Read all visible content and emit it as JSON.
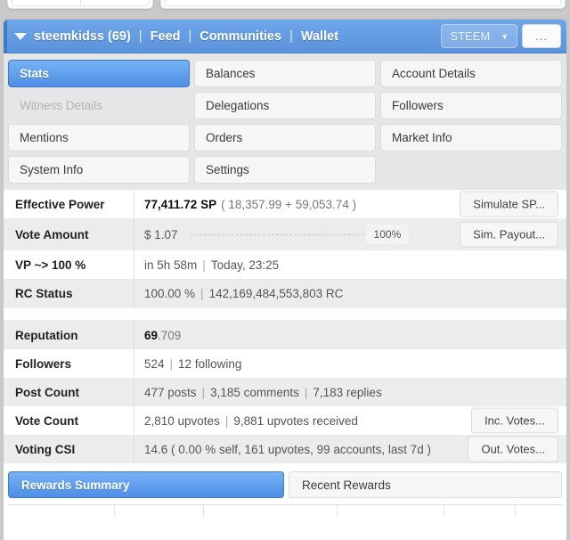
{
  "header": {
    "caret_icon": "caret-down-icon",
    "account": "steemkidss (69)",
    "nav_feed": "Feed",
    "nav_communities": "Communities",
    "nav_wallet": "Wallet",
    "separator": "|",
    "currency_selected": "STEEM",
    "currency_caret_icon": "chevron-down-icon",
    "more_label": "...",
    "accent_color": "#5b93dc"
  },
  "tabs": [
    {
      "label": "Stats",
      "state": "active"
    },
    {
      "label": "Balances",
      "state": "idle"
    },
    {
      "label": "Account Details",
      "state": "idle"
    },
    {
      "label": "Witness Details",
      "state": "disabled"
    },
    {
      "label": "Delegations",
      "state": "idle"
    },
    {
      "label": "Followers",
      "state": "idle"
    },
    {
      "label": "Mentions",
      "state": "idle"
    },
    {
      "label": "Orders",
      "state": "idle"
    },
    {
      "label": "Market Info",
      "state": "idle"
    },
    {
      "label": "System Info",
      "state": "idle"
    },
    {
      "label": "Settings",
      "state": "idle"
    },
    {
      "label": "",
      "state": "empty"
    }
  ],
  "stats_group_1": [
    {
      "label": "Effective Power",
      "value_strong": "77,411.72 SP",
      "value_rest": "( 18,357.99 + 59,053.74 )",
      "button": "Simulate SP..."
    },
    {
      "label": "Vote Amount",
      "value_strong": "$ 1.07",
      "percent": "100%",
      "button": "Sim. Payout..."
    },
    {
      "label": "VP ~> 100 %",
      "part_a": "in 5h 58m",
      "pipe": "|",
      "part_b": "Today, 23:25"
    },
    {
      "label": "RC Status",
      "part_a": "100.00 %",
      "pipe": "|",
      "part_b": "142,169,484,553,803 RC"
    }
  ],
  "stats_group_2": [
    {
      "label": "Reputation",
      "value_strong": "69",
      "value_rest": ".709"
    },
    {
      "label": "Followers",
      "part_a": "524",
      "pipe": "|",
      "part_b": "12 following"
    },
    {
      "label": "Post Count",
      "part_a": "477 posts",
      "pipe": "|",
      "part_b": "3,185 comments",
      "pipe2": "|",
      "part_c": "7,183 replies"
    },
    {
      "label": "Vote Count",
      "part_a": "2,810 upvotes",
      "pipe": "|",
      "part_b": "9,881 upvotes received",
      "button": "Inc. Votes..."
    },
    {
      "label": "Voting CSI",
      "value_rest": "14.6 ( 0.00 % self, 161 upvotes, 99 accounts, last 7d )",
      "button": "Out. Votes..."
    }
  ],
  "bottom_tabs": [
    {
      "label": "Rewards Summary",
      "state": "active"
    },
    {
      "label": "Recent Rewards",
      "state": "idle"
    }
  ]
}
